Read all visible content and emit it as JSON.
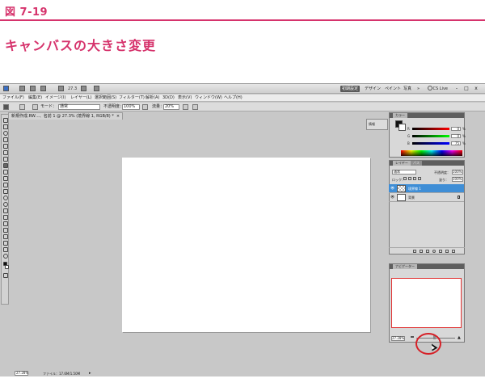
{
  "figure_label": "図 7-19",
  "heading": "キャンバスの大きさ変更",
  "app": {
    "zoom_dropdown": "27.3",
    "workspace_buttons": [
      {
        "label": "初期設定",
        "active": true
      },
      {
        "label": "デザイン",
        "active": false
      },
      {
        "label": "ペイント",
        "active": false
      },
      {
        "label": "写真",
        "active": false
      },
      {
        "label": "»",
        "active": false
      }
    ],
    "cs_live": "CS Live",
    "window_controls": [
      "-",
      "□",
      "x"
    ],
    "menu": [
      "ファイル(F)",
      "編集(E)",
      "イメージ(I)",
      "レイヤー(L)",
      "選択範囲(S)",
      "フィルター(T)",
      "解析(A)",
      "3D(D)",
      "表示(V)",
      "ウィンドウ(W)",
      "ヘルプ(H)"
    ],
    "options": {
      "mode_label": "モード：",
      "mode_value": "通常",
      "opacity_label": "不透明度：",
      "opacity_value": "100%",
      "flow_label": "流量：",
      "flow_value": "20%"
    },
    "document_tab": "新規作成.RW…、名前 1 @ 27.3% (境界線 1, RGB/8) *",
    "document_tab_close": "×",
    "history_panel": {
      "label": "情報"
    },
    "color_panel": {
      "tab": "カラー",
      "rows": [
        {
          "label": "R",
          "value": "0",
          "unit": "%"
        },
        {
          "label": "G",
          "value": "0",
          "unit": "%"
        },
        {
          "label": "B",
          "value": "75",
          "unit": "%"
        }
      ]
    },
    "layers_panel": {
      "tabs": [
        "レイヤー",
        "パス"
      ],
      "blend_mode": "通常",
      "opacity_label": "不透明度：",
      "opacity_value": "100%",
      "lock_label": "ロック：",
      "fill_label": "塗り：",
      "fill_value": "100%",
      "layers": [
        {
          "name": "境界線 1",
          "selected": true,
          "transparent": true,
          "locked": false
        },
        {
          "name": "背景",
          "selected": false,
          "transparent": false,
          "locked": true
        }
      ]
    },
    "navigator_panel": {
      "tab": "ナビゲーター",
      "zoom": "27.28%"
    },
    "status": {
      "zoom": "27.28%",
      "file_info": "ファイル：17.6M/1.50M"
    }
  },
  "colors": {
    "accent": "#d6336c",
    "selection_blue": "#3f8ed6",
    "navigator_box": "#e03232",
    "annotation_circle": "#d62027"
  }
}
